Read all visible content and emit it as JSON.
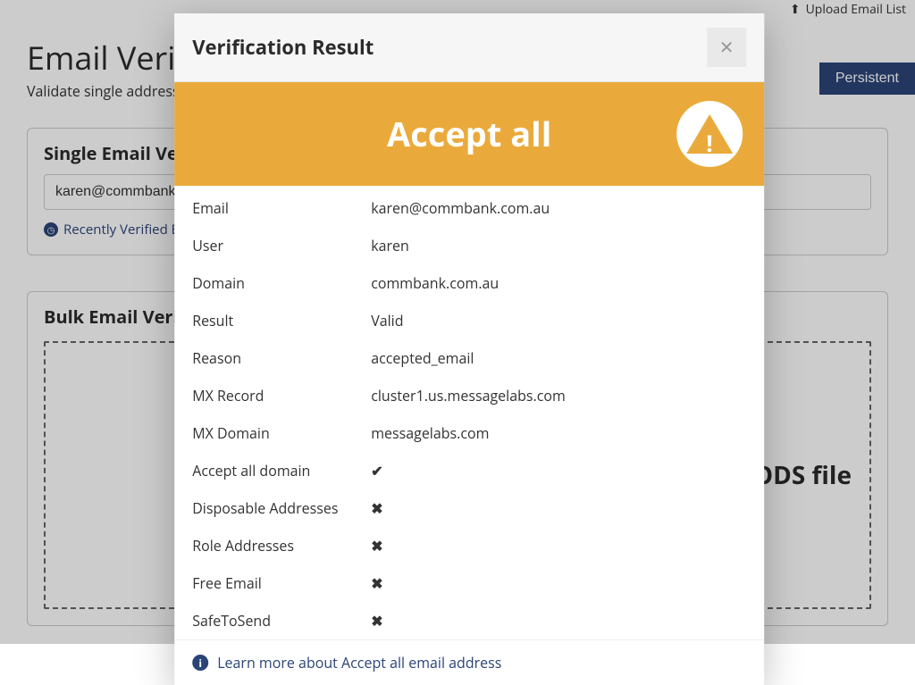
{
  "page": {
    "title": "Email Verification",
    "subtitle": "Validate single address or upload list",
    "upload_link": "Upload Email List",
    "persist_button": "Persistent"
  },
  "single_panel": {
    "title": "Single Email Verification",
    "input_value": "karen@commbank.com.au",
    "recent_link": "Recently Verified Emails"
  },
  "bulk_panel": {
    "title": "Bulk Email Verification",
    "dropzone_hint": "ODS file"
  },
  "modal": {
    "title": "Verification Result",
    "banner": "Accept all",
    "rows": {
      "email": {
        "label": "Email",
        "value": "karen@commbank.com.au"
      },
      "user": {
        "label": "User",
        "value": "karen"
      },
      "domain": {
        "label": "Domain",
        "value": "commbank.com.au"
      },
      "result": {
        "label": "Result",
        "value": "Valid"
      },
      "reason": {
        "label": "Reason",
        "value": "accepted_email"
      },
      "mx_record": {
        "label": "MX Record",
        "value": "cluster1.us.messagelabs.com"
      },
      "mx_domain": {
        "label": "MX Domain",
        "value": "messagelabs.com"
      },
      "accept_all": {
        "label": "Accept all domain",
        "icon": "check"
      },
      "disposable": {
        "label": "Disposable Addresses",
        "icon": "x"
      },
      "role": {
        "label": "Role Addresses",
        "icon": "x"
      },
      "free_email": {
        "label": "Free Email",
        "icon": "x"
      },
      "safe_to_send": {
        "label": "SafeToSend",
        "icon": "x"
      }
    },
    "learn_more": "Learn more about Accept all email address"
  }
}
